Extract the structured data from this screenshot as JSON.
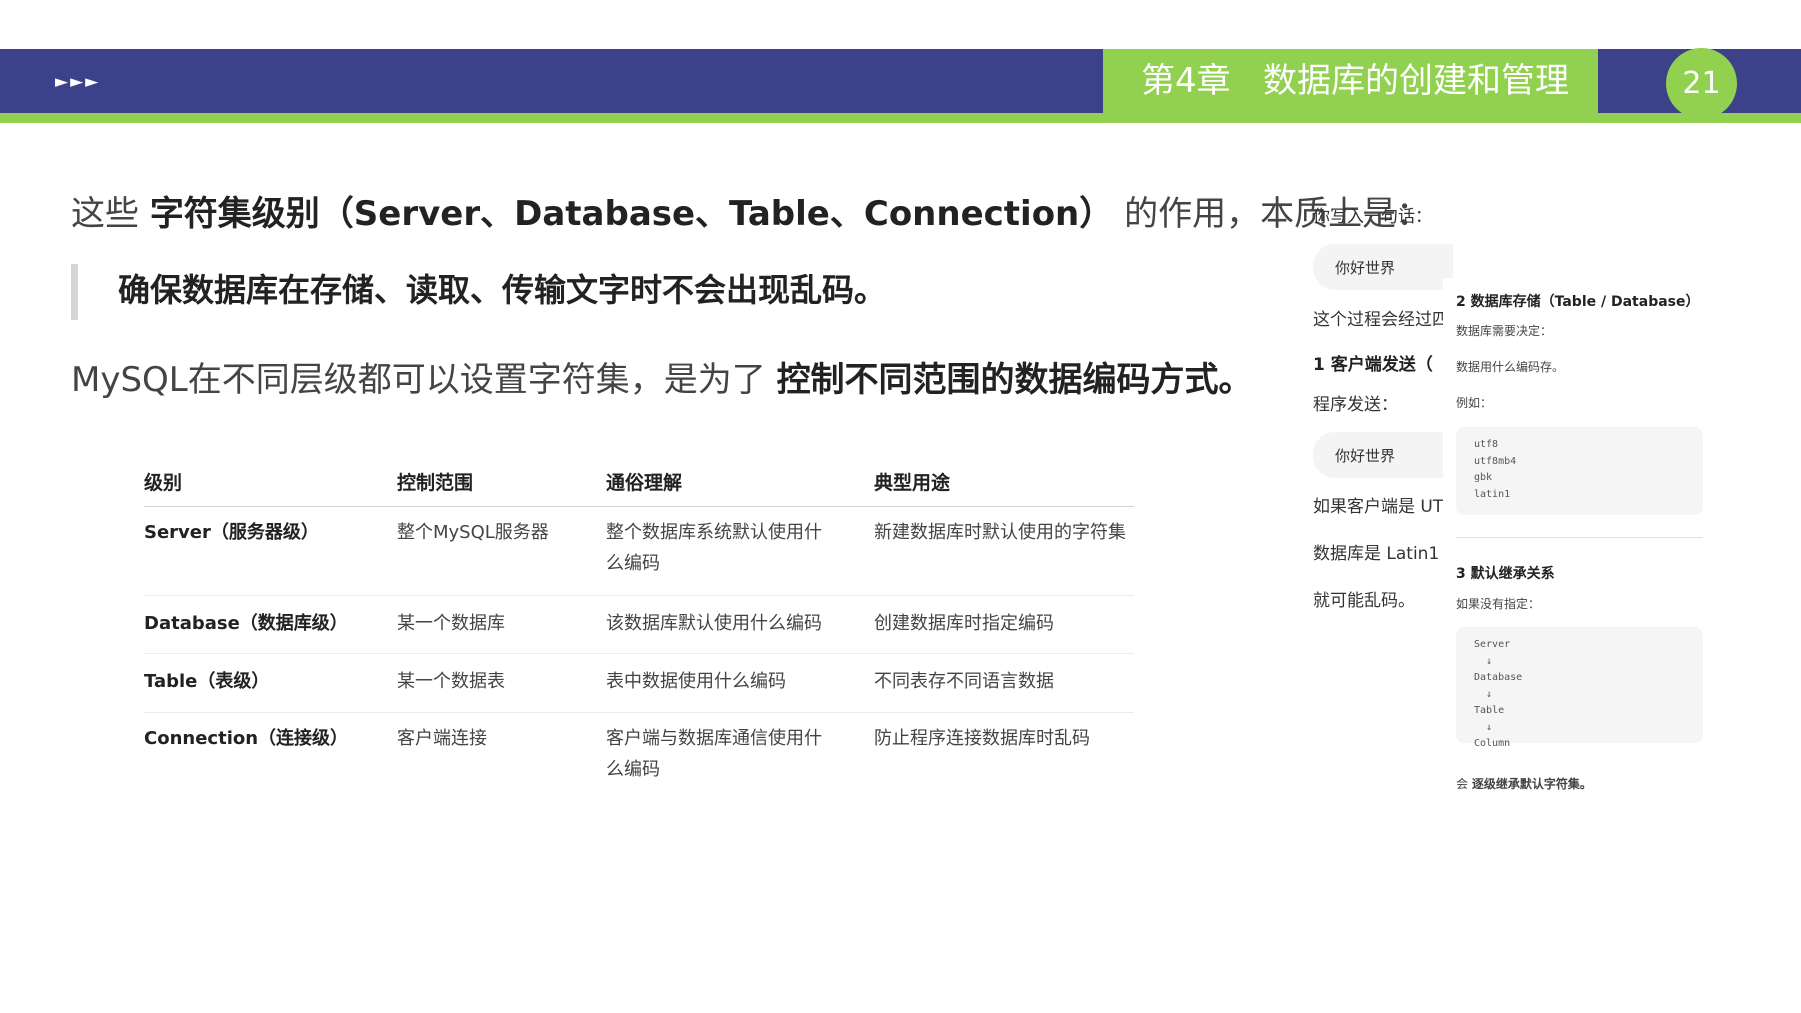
{
  "header": {
    "arrows": "►►►",
    "chapter_title": "第4章   数据库的创建和管理",
    "page_number": "21",
    "colors": {
      "band": "#3c4189",
      "accent": "#92d050"
    }
  },
  "main": {
    "intro": {
      "pre": "这些 ",
      "bold": "字符集级别（Server、Database、Table、Connection）",
      "post": " 的作用，本质上是："
    },
    "quote": "确保数据库在存储、读取、传输文字时不会出现乱码。",
    "para": {
      "pre": "MySQL在不同层级都可以设置字符集，是为了 ",
      "bold": "控制不同范围的数据编码方式。"
    }
  },
  "table": {
    "headers": [
      "级别",
      "控制范围",
      "通俗理解",
      "典型用途"
    ],
    "rows": [
      [
        "Server（服务器级）",
        "整个MySQL服务器",
        "整个数据库系统默认使用什么编码",
        "新建数据库时默认使用的字符集"
      ],
      [
        "Database（数据库级）",
        "某一个数据库",
        "该数据库默认使用什么编码",
        "创建数据库时指定编码"
      ],
      [
        "Table（表级）",
        "某一个数据表",
        "表中数据使用什么编码",
        "不同表存不同语言数据"
      ],
      [
        "Connection（连接级）",
        "客户端连接",
        "客户端与数据库通信使用什么编码",
        "防止程序连接数据库时乱码"
      ]
    ]
  },
  "chat": {
    "line1": "你写入一句话：",
    "bubble1": "你好世界",
    "line2": "这个过程会经过四",
    "step1": "1 客户端发送（",
    "line3": "程序发送：",
    "bubble2": "你好世界",
    "line4": "如果客户端是 UT",
    "line5": "数据库是 Latin1",
    "line6": "就可能乱码。"
  },
  "doc": {
    "h2": "2 数据库存储（Table / Database）",
    "p1": "数据库需要决定：",
    "p2": "数据用什么编码存。",
    "p3": "例如：",
    "code1": "utf8\nutf8mb4\ngbk\nlatin1",
    "h3": "3 默认继承关系",
    "p4": "如果没有指定：",
    "code2": "Server\n  ↓\nDatabase\n  ↓\nTable\n  ↓\nColumn",
    "note_arrow": "会 ",
    "note_bold": "逐级继承默认字符集。"
  }
}
